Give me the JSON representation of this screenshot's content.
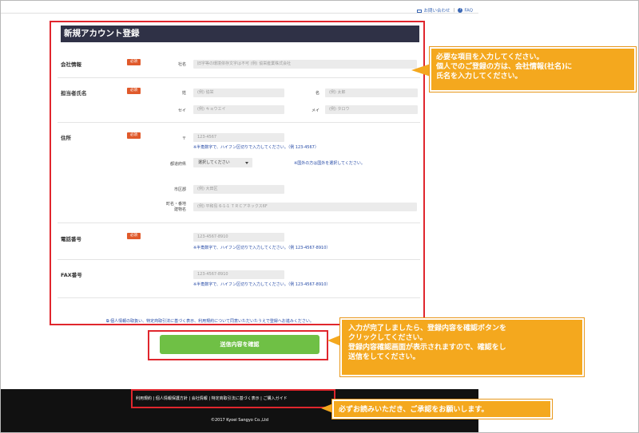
{
  "topnav": {
    "contact": "お問い合わせ",
    "separator": "|",
    "faq": "FAQ"
  },
  "form": {
    "title": "新規アカウント登録",
    "required_badge": "必須",
    "company": {
      "label": "会社情報",
      "sub": "社名",
      "placeholder": "旧字等の環境依存文字は不可 (例) 協栄産業株式会社"
    },
    "person": {
      "label": "担当者氏名",
      "sei_label": "姓",
      "sei_placeholder": "(例) 協栄",
      "mei_label": "名",
      "mei_placeholder": "(例) 太郎",
      "sei_kana_label": "セイ",
      "sei_kana_placeholder": "(例) キョウエイ",
      "mei_kana_label": "メイ",
      "mei_kana_placeholder": "(例) タロウ"
    },
    "address": {
      "label": "住所",
      "zip_label": "〒",
      "zip_placeholder": "123-4567",
      "zip_note": "※半角数字で、ハイフン区切りで入力してください。（例 123-4567）",
      "pref_label": "都道府県",
      "pref_value": "選択してください",
      "pref_note": "※国外の方は国外を選択してください。",
      "city_label": "市区郡",
      "city_placeholder": "(例) 大田区",
      "street_label_1": "町名・番地",
      "street_label_2": "建物名",
      "street_placeholder": "(例) 平和島 6-1-1 ＴＲＣアネックス6F"
    },
    "phone": {
      "label": "電話番号",
      "placeholder": "123-4567-8910",
      "note": "※半角数字で、ハイフン区切りで入力してください。（例 123-4567-8910）"
    },
    "fax": {
      "label": "FAX番号",
      "placeholder": "123-4567-8910",
      "note": "※半角数字で、ハイフン区切りで入力してください。（例 123-4567-8910）"
    }
  },
  "privacy_text": "個人情報の取扱い、特定商取引法に基づく表示、利用規約について同意いただいたうえで登録へお進みください。",
  "submit_button": "送信内容を確認",
  "footer": {
    "links": "利用規約 | 個人情報保護方針 | 会社情報 | 特定商取引法に基づく表示 | ご購入ガイド",
    "copyright": "©2017 Kyoei Sangyo Co.,Ltd"
  },
  "callouts": {
    "c1": [
      "必要な項目を入力してください。",
      "個人でのご登録の方は、会社情報(社名)に",
      "氏名を入力してください。"
    ],
    "c2": [
      "入力が完了しましたら、登録内容を確認ボタンを",
      "クリックしてください。",
      "登録内容確認画面が表示されますので、確認をし",
      "送信をしてください。"
    ],
    "c3": [
      "必ずお読みいただき、ご承認をお願いします。"
    ]
  },
  "colors": {
    "accent_red": "#e0262d",
    "callout_orange": "#f4a81e",
    "button_green": "#6fc045",
    "title_bar": "#2f3146"
  }
}
